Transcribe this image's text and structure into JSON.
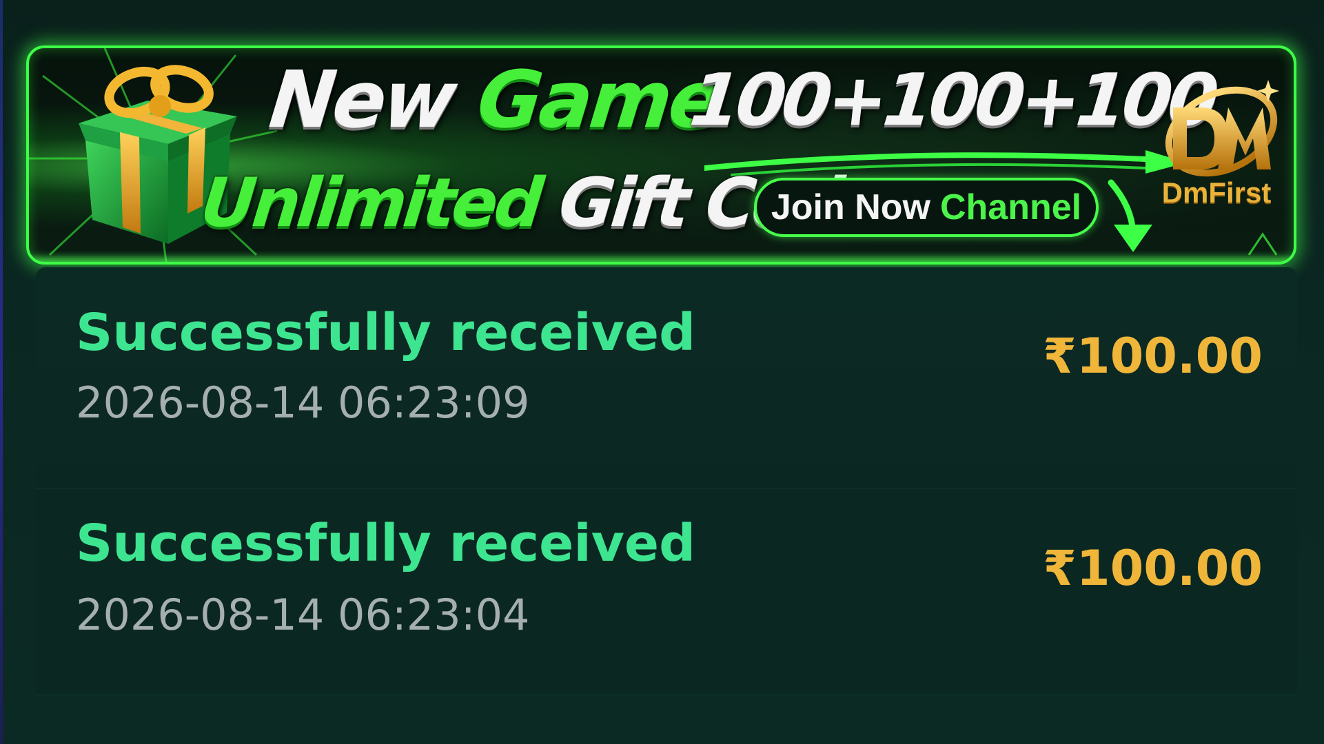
{
  "banner": {
    "headline_word1": "New",
    "headline_word2": "Game",
    "bonus_text": "100+100+100",
    "subline_word1": "Unlimited",
    "subline_word2": "Gift Code",
    "join_label_part1": "Join Now",
    "join_label_part2": "Channel",
    "logo_text": "DmFirst",
    "colors": {
      "border": "#3dff45",
      "green_text": "#46ef3a",
      "logo_gold": "#e9b33b"
    }
  },
  "records": [
    {
      "status": "Successfully received",
      "timestamp": "2026-08-14 06:23:09",
      "amount": "₹100.00"
    },
    {
      "status": "Successfully received",
      "timestamp": "2026-08-14 06:23:04",
      "amount": "₹100.00"
    }
  ],
  "colors": {
    "status_green": "#3ee590",
    "amount_gold": "#f0b63a",
    "timestamp_gray": "#a5aeb0",
    "background": "#0b2722"
  }
}
